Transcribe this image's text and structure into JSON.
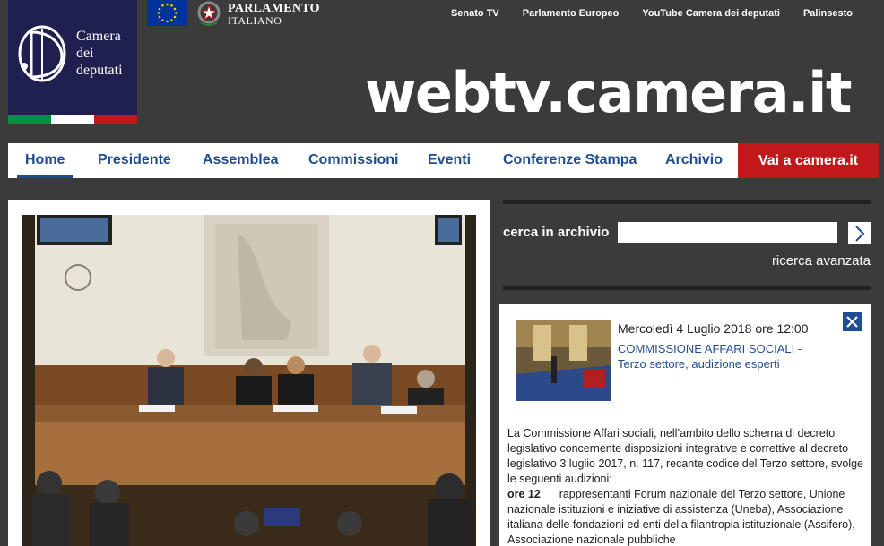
{
  "header": {
    "logo_lines": [
      "Camera",
      "dei",
      "deputati"
    ],
    "flag_colors": [
      "#00923f",
      "#ffffff",
      "#c1181c"
    ],
    "parliament_line1": "PARLAMENTO",
    "parliament_line2": "ITALIANO",
    "top_links": [
      "Senato TV",
      "Parlamento Europeo",
      "YouTube Camera dei deputati",
      "Palinsesto"
    ],
    "site_title": "webtv.camera.it"
  },
  "nav": {
    "items": [
      "Home",
      "Presidente",
      "Assemblea",
      "Commissioni",
      "Eventi",
      "Conferenze Stampa",
      "Archivio"
    ],
    "active": "Home",
    "cta_label": "Vai a camera.it"
  },
  "search": {
    "label": "cerca in archivio",
    "value": "",
    "placeholder": "",
    "advanced_label": "ricerca avanzata"
  },
  "event": {
    "date": "Mercoledì 4 Luglio 2018 ore 12:00",
    "title": "COMMISSIONE AFFARI SOCIALI - Terzo settore, audizione esperti",
    "body": "La Commissione Affari sociali, nell’ambito dello schema di decreto legislativo concernente disposizioni integrative e correttive al decreto legislativo 3 luglio 2017, n. 117, recante codice del Terzo settore, svolge le seguenti audizioni:",
    "time_label": "ore 12",
    "time_text": "rappresentanti Forum nazionale del Terzo settore, Unione nazionale istituzioni e iniziative di assistenza (Uneba), Associazione italiana delle fondazioni ed enti della filantropia istituzionale (Assifero), Associazione nazionale pubbliche"
  },
  "colors": {
    "page_bg": "#3b3b3b",
    "logo_bg": "#1f2050",
    "nav_text": "#1f4d8f",
    "cta_bg": "#c1181c"
  },
  "icons": [
    "camera-logo-icon",
    "eu-flag-icon",
    "italy-emblem-icon",
    "chevron-right-icon",
    "close-icon"
  ]
}
